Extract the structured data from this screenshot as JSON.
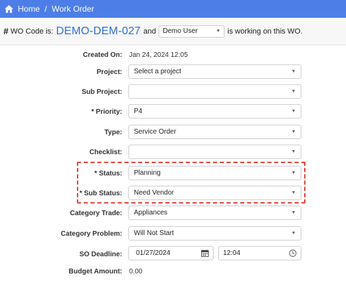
{
  "breadcrumb": {
    "home": "Home",
    "separator": "/",
    "current": "Work Order"
  },
  "wo_header": {
    "prefix_symbol": "#",
    "prefix_text": "WO Code is:",
    "code": "DEMO-DEM-027",
    "and_text": "and",
    "user_selected": "Demo User",
    "suffix_text": "is working on this WO."
  },
  "form": {
    "created_on": {
      "label": "Created On:",
      "value": "Jan 24, 2024 12:05"
    },
    "project": {
      "label": "Project:",
      "value": "Select a project"
    },
    "sub_project": {
      "label": "Sub Project:",
      "value": ""
    },
    "priority": {
      "label": "* Priority:",
      "value": "P4"
    },
    "type": {
      "label": "Type:",
      "value": "Service Order"
    },
    "checklist": {
      "label": "Checklist:",
      "value": ""
    },
    "status": {
      "label": "* Status:",
      "value": "Planning"
    },
    "sub_status": {
      "label": "* Sub Status:",
      "value": "Need Vendor"
    },
    "category_trade": {
      "label": "Category Trade:",
      "value": "Appliances"
    },
    "category_problem": {
      "label": "Category Problem:",
      "value": "Will Not Start"
    },
    "so_deadline": {
      "label": "SO Deadline:",
      "date": "01/27/2024",
      "time": "12:04"
    },
    "budget_amount": {
      "label": "Budget Amount:",
      "value": "0.00"
    }
  },
  "colors": {
    "topbar": "#4d7ee8",
    "code": "#2c6fd6",
    "highlight": "#e0463c"
  }
}
